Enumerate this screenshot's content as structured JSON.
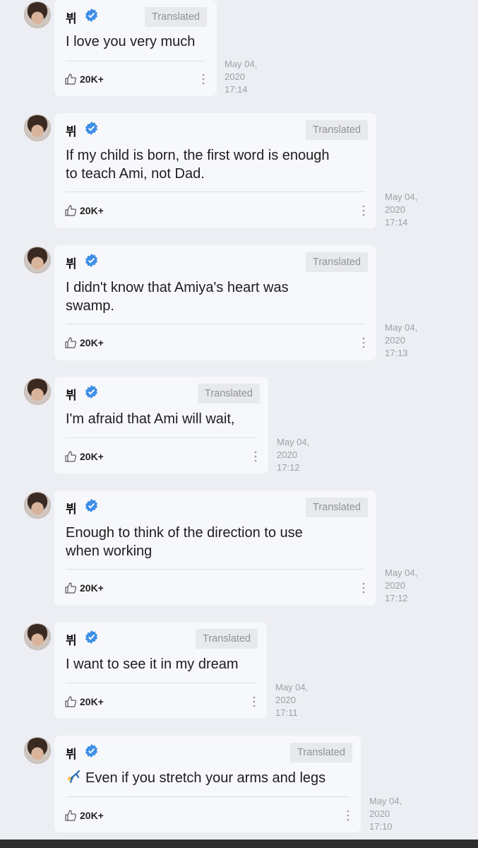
{
  "badge_label": "Translated",
  "messages": [
    {
      "name": "뷔",
      "text": "I love you very much",
      "likes": "20K+",
      "date_line1": "May 04,",
      "date_line2": "2020",
      "time": "17:14"
    },
    {
      "name": "뷔",
      "text_line1": "If my child is born, the first word is enough",
      "text_line2": "to teach Ami, not Dad.",
      "likes": "20K+",
      "date_line1": "May 04,",
      "date_line2": "2020",
      "time": "17:14"
    },
    {
      "name": "뷔",
      "text_line1": "I didn't know that Amiya's heart was",
      "text_line2": "swamp.",
      "likes": "20K+",
      "date_line1": "May 04,",
      "date_line2": "2020",
      "time": "17:13"
    },
    {
      "name": "뷔",
      "text": "I'm afraid that Ami will wait,",
      "likes": "20K+",
      "date_line1": "May 04,",
      "date_line2": "2020",
      "time": "17:12"
    },
    {
      "name": "뷔",
      "text_line1": "Enough to think of the direction to use",
      "text_line2": "when working",
      "likes": "20K+",
      "date_line1": "May 04,",
      "date_line2": "2020",
      "time": "17:12"
    },
    {
      "name": "뷔",
      "text": "I want to see it in my dream",
      "likes": "20K+",
      "date_line1": "May 04,",
      "date_line2": "2020",
      "time": "17:11"
    },
    {
      "name": "뷔",
      "emoji": "🤸",
      "text": "Even if you stretch your arms and legs",
      "likes": "20K+",
      "date_line1": "May 04,",
      "date_line2": "2020",
      "time": "17:10"
    }
  ],
  "colors": {
    "verified": "#3f8fe6",
    "badge_bg": "#e8e9ed",
    "bubble_bg": "#f7f8fb",
    "page_bg": "#eceef3"
  }
}
